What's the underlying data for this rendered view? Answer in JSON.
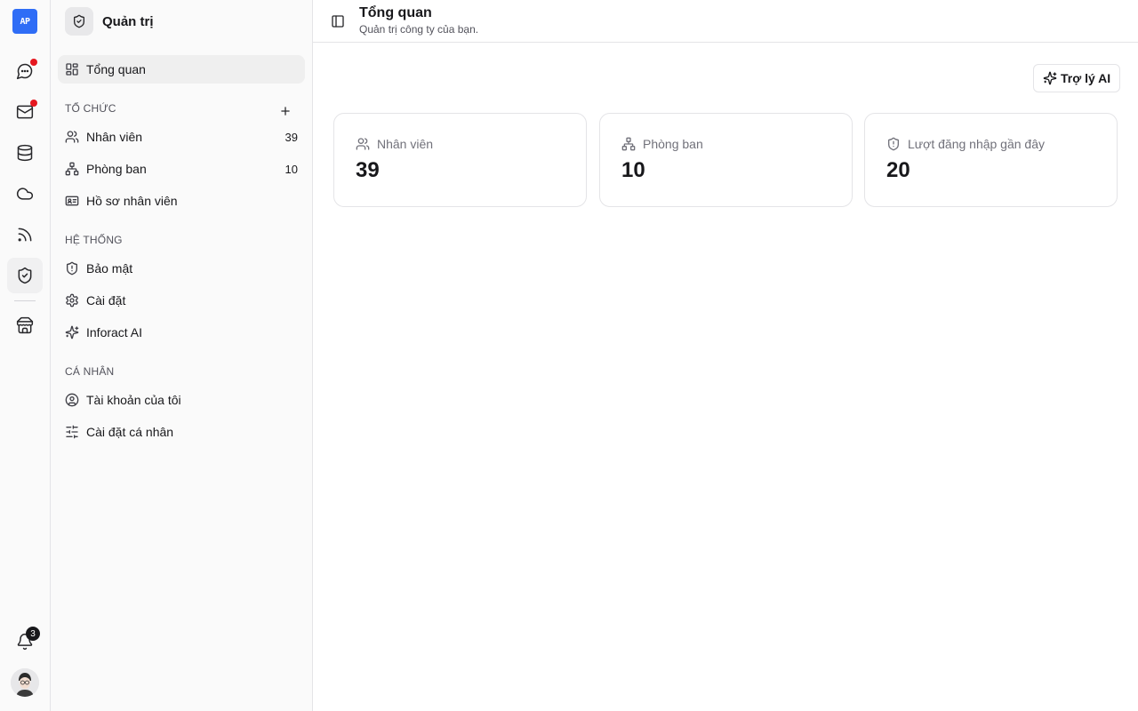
{
  "rail": {
    "logo_text": "AP",
    "items": [
      {
        "icon": "chat-icon",
        "dot": true
      },
      {
        "icon": "mail-icon",
        "dot": true
      },
      {
        "icon": "database-icon",
        "dot": false
      },
      {
        "icon": "cloud-icon",
        "dot": false
      },
      {
        "icon": "rss-icon",
        "dot": false
      },
      {
        "icon": "shield-check-icon",
        "dot": false,
        "active": true
      },
      {
        "icon": "store-icon",
        "dot": false
      }
    ],
    "notifications_count": "3",
    "dot_color": "#e5171f",
    "logo_color": "#2f6df6"
  },
  "sidebar": {
    "title": "Quản trị",
    "overview": "Tổng quan",
    "sections": {
      "organization": "TỔ CHỨC",
      "system": "HỆ THỐNG",
      "personal": "CÁ NHÂN"
    },
    "items": {
      "employees": {
        "label": "Nhân viên",
        "count": "39"
      },
      "departments": {
        "label": "Phòng ban",
        "count": "10"
      },
      "profiles": {
        "label": "Hồ sơ nhân viên"
      },
      "security": {
        "label": "Bảo mật"
      },
      "settings": {
        "label": "Cài đặt"
      },
      "ai": {
        "label": "Inforact AI"
      },
      "account": {
        "label": "Tài khoản của tôi"
      },
      "personal_settings": {
        "label": "Cài đặt cá nhân"
      }
    }
  },
  "header": {
    "title": "Tổng quan",
    "subtitle": "Quản trị công ty của bạn."
  },
  "main": {
    "ai_button": "Trợ lý AI",
    "stats": [
      {
        "label": "Nhân viên",
        "value": "39",
        "icon": "users-icon"
      },
      {
        "label": "Phòng ban",
        "value": "10",
        "icon": "org-chart-icon"
      },
      {
        "label": "Lượt đăng nhập gần đây",
        "value": "20",
        "icon": "shield-alert-icon"
      }
    ]
  }
}
